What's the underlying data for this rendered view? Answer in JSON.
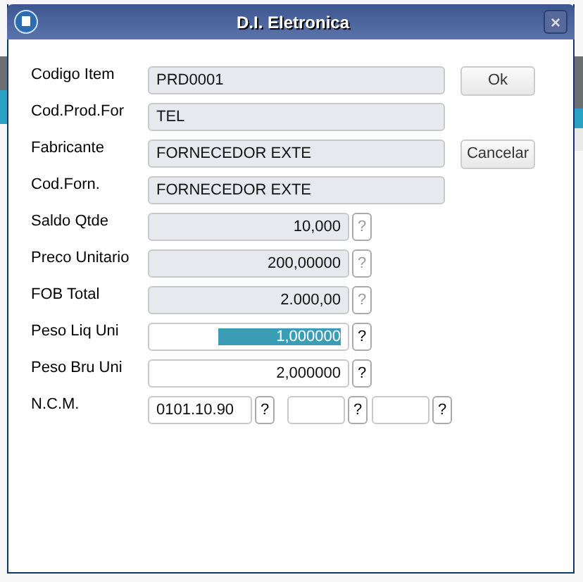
{
  "window": {
    "title": "D.I. Eletronica",
    "close": "×"
  },
  "fields": [
    {
      "label": "Codigo Item",
      "value": "PRD0001",
      "kind": "text",
      "readonly": true,
      "button": "Ok"
    },
    {
      "label": "Cod.Prod.For",
      "value": "TEL",
      "kind": "text",
      "readonly": true
    },
    {
      "label": "Fabricante",
      "value": "FORNECEDOR EXTE",
      "kind": "text",
      "readonly": true,
      "button": "Cancelar"
    },
    {
      "label": "Cod.Forn.",
      "value": "FORNECEDOR EXTE",
      "kind": "text",
      "readonly": true
    },
    {
      "label": "Saldo Qtde",
      "value": "10,000",
      "kind": "number",
      "readonly": true,
      "help": "?",
      "selected": false
    },
    {
      "label": "Preco Unitario",
      "value": "200,00000",
      "kind": "number",
      "readonly": true,
      "help": "?",
      "selected": false
    },
    {
      "label": "FOB Total",
      "value": "2.000,00",
      "kind": "number",
      "readonly": true,
      "help": "?",
      "selected": false
    },
    {
      "label": "Peso Liq Uni",
      "value": "1,000000",
      "kind": "number",
      "readonly": false,
      "help": "?",
      "selected": true
    },
    {
      "label": "Peso Bru Uni",
      "value": "2,000000",
      "kind": "number",
      "readonly": false,
      "help": "?",
      "selected": false
    },
    {
      "label": "N.C.M.",
      "kind": "ncm",
      "parts": [
        {
          "value": "0101.10.90",
          "help": "?"
        },
        {
          "help": "?"
        },
        {
          "help": "?"
        }
      ]
    }
  ]
}
